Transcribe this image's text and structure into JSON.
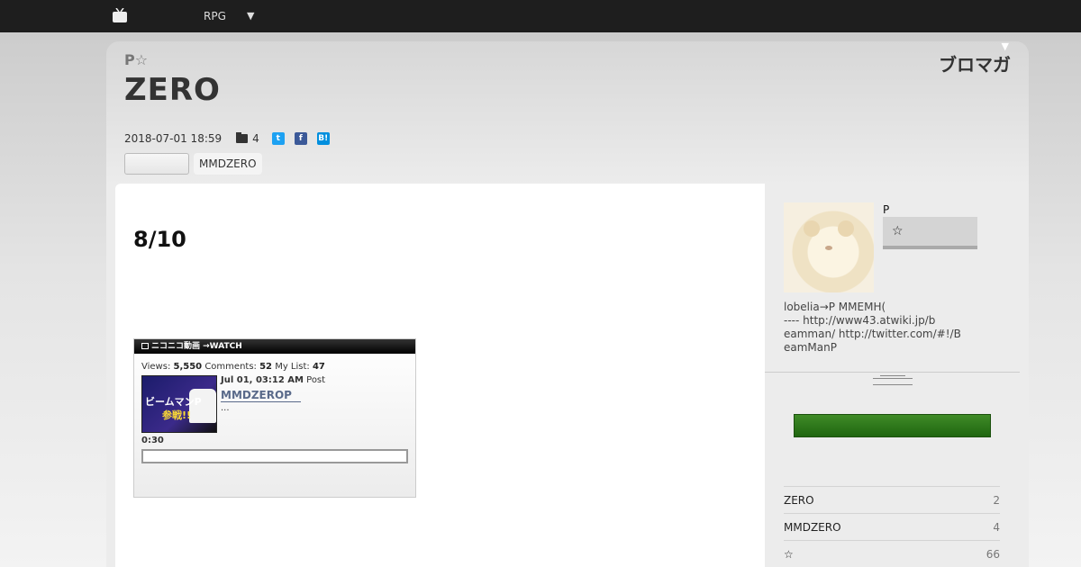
{
  "topbar": {
    "nav_cat": "",
    "nav_rpg": "RPG",
    "nav_drop": "▼",
    "nav_right": ""
  },
  "blog": {
    "prefix": "P☆",
    "title": "ZERO",
    "brand": "ブロマガ",
    "brand_arrow": "▼"
  },
  "post": {
    "date": "2018-07-01 18:59",
    "folder_count": "4",
    "share": {
      "twitter": "t",
      "facebook": "f",
      "hatena": "B!"
    },
    "tags": [
      "",
      "MMDZERO"
    ],
    "title": "8/10"
  },
  "nico": {
    "header": "ニコニコ動画 →WATCH",
    "views_label": "Views:",
    "views": "5,550",
    "comments_label": "Comments:",
    "comments": "52",
    "mylist_label": "My List:",
    "mylist": "47",
    "thumb_line1": "ビームマンP",
    "thumb_line2": "参戦!!",
    "post_date": "Jul 01, 03:12 AM",
    "post_label": "Post",
    "link_title": "MMDZEROP",
    "desc": "...",
    "duration": "0:30"
  },
  "sidebar": {
    "author_name": "P",
    "follow_star": "☆",
    "profile": "lobelia→P  MMEMH(\n ---- http://www43.atwiki.jp/b\neamman/  http://twitter.com/#!/B\neamManP",
    "categories": [
      {
        "name": "ZERO",
        "count": "2"
      },
      {
        "name": "MMDZERO",
        "count": "4"
      },
      {
        "name": "☆",
        "count": "66"
      }
    ]
  },
  "colors": {
    "topbar": "#1e1e1e",
    "accent_green": "#2f7a1c",
    "link": "#5a6a8a"
  }
}
